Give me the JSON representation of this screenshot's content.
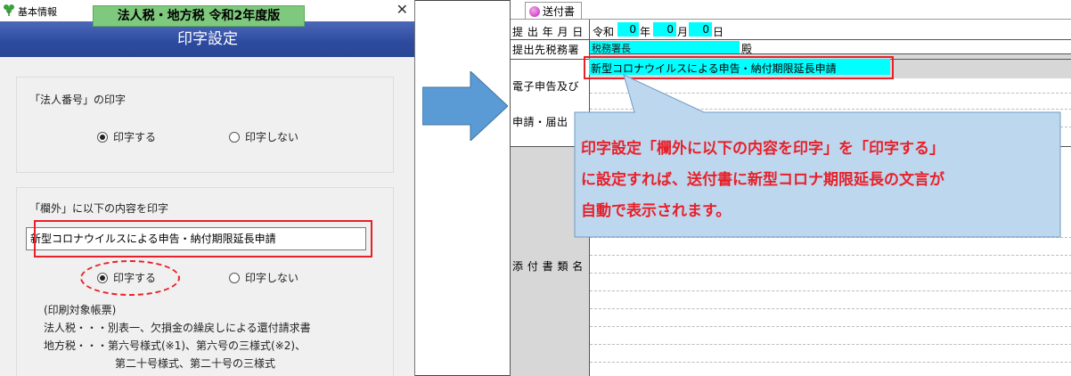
{
  "dialog": {
    "app_title": "基本情報",
    "close_symbol": "✕",
    "product_badge": "法人税・地方税 令和2年度版",
    "header_title": "印字設定",
    "group1": {
      "title": "「法人番号」の印字",
      "option_print": "印字する",
      "option_noprint": "印字しない",
      "selected": "印字する"
    },
    "group2": {
      "title": "「欄外」に以下の内容を印字",
      "field_value": "新型コロナウイルスによる申告・納付期限延長申請",
      "option_print": "印字する",
      "option_noprint": "印字しない",
      "selected": "印字する",
      "notes": [
        "(印刷対象帳票)",
        "法人税・・・別表一、欠損金の繰戻しによる還付請求書",
        "地方税・・・第六号様式(※1)、第六号の三様式(※2)、",
        "第二十号様式、第二十号の三様式"
      ]
    }
  },
  "document": {
    "tab_label": "送付書",
    "rows": {
      "submit_date_label": "提 出 年 月 日",
      "era": "令和",
      "year_value": "0",
      "year_unit": "年",
      "month_value": "0",
      "month_unit": "月",
      "day_value": "0",
      "day_unit": "日",
      "office_label": "提出先税務署",
      "office_value": "税務署長",
      "office_suffix": "殿",
      "margin_text": "新型コロナウイルスによる申告・納付期限延長申請",
      "efile_label": "電子申告及び",
      "apply_label": "申請・届出",
      "attach_label": "添 付 書 類 名"
    }
  },
  "callout": {
    "lines": [
      "印字設定「欄外に以下の内容を印字」を「印字する」",
      "に設定すれば、送付書に新型コロナ期限延長の文言が",
      "自動で表示されます。"
    ]
  },
  "colors": {
    "highlight_red": "#e8202a",
    "header_blue": "#2c4a9e",
    "badge_green": "#7fc97f",
    "callout_fill": "#bdd7ee",
    "arrow_blue": "#5b9bd5",
    "field_cyan": "#00ffff"
  }
}
